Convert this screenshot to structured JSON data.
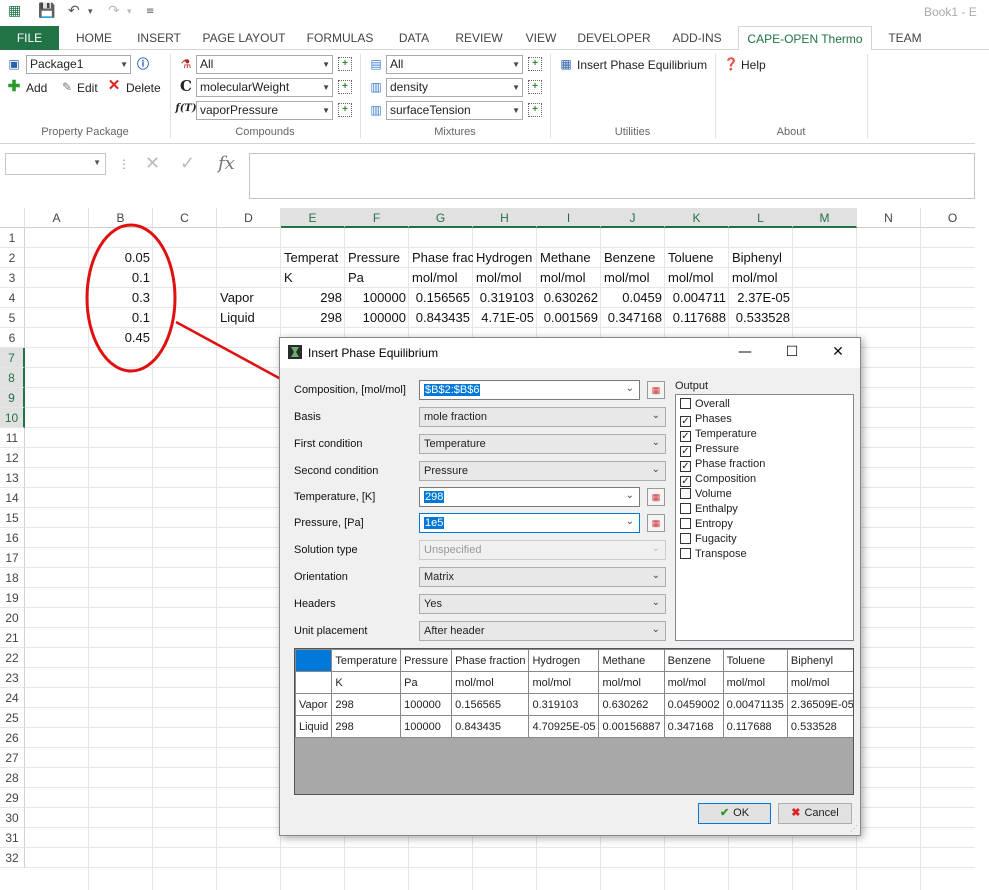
{
  "window": {
    "book_title": "Book1 - E"
  },
  "ribbon_tabs": [
    "FILE",
    "HOME",
    "INSERT",
    "PAGE LAYOUT",
    "FORMULAS",
    "DATA",
    "REVIEW",
    "VIEW",
    "DEVELOPER",
    "ADD-INS",
    "CAPE-OPEN Thermo",
    "TEAM"
  ],
  "ribbon": {
    "property_package": {
      "selected": "Package1",
      "add": "Add",
      "edit": "Edit",
      "delete": "Delete",
      "label": "Property Package"
    },
    "compounds": {
      "filter": "All",
      "prop1": "molecularWeight",
      "prop2": "vaporPressure",
      "c_glyph": "C",
      "f_glyph": "f(T)",
      "label": "Compounds"
    },
    "mixtures": {
      "filter": "All",
      "prop1": "density",
      "prop2": "surfaceTension",
      "label": "Mixtures"
    },
    "utilities": {
      "insert": "Insert Phase Equilibrium",
      "label": "Utilities"
    },
    "about": {
      "help": "Help",
      "label": "About"
    }
  },
  "formula_bar": {
    "fx": "fx",
    "value": ""
  },
  "sheet": {
    "columns": [
      "A",
      "B",
      "C",
      "D",
      "E",
      "F",
      "G",
      "H",
      "I",
      "J",
      "K",
      "L",
      "M",
      "N",
      "O"
    ],
    "rows": [
      "1",
      "2",
      "3",
      "4",
      "5",
      "6",
      "7",
      "8",
      "9",
      "10",
      "11",
      "12",
      "13",
      "14",
      "15",
      "16",
      "17",
      "18",
      "19",
      "20",
      "21",
      "22",
      "23",
      "24",
      "25",
      "26",
      "27",
      "28",
      "29",
      "30",
      "31",
      "32"
    ],
    "b_values": [
      "0.05",
      "0.1",
      "0.3",
      "0.1",
      "0.45"
    ],
    "d_labels": [
      "Vapor",
      "Liquid"
    ],
    "headers": [
      "Temperat",
      "Pressure",
      "Phase frac",
      "Hydrogen",
      "Methane",
      "Benzene",
      "Toluene",
      "Biphenyl"
    ],
    "units": [
      "K",
      "Pa",
      "mol/mol",
      "mol/mol",
      "mol/mol",
      "mol/mol",
      "mol/mol",
      "mol/mol"
    ],
    "vapor": [
      "298",
      "100000",
      "0.156565",
      "0.319103",
      "0.630262",
      "0.0459",
      "0.004711",
      "2.37E-05"
    ],
    "liquid": [
      "298",
      "100000",
      "0.843435",
      "4.71E-05",
      "0.001569",
      "0.347168",
      "0.117688",
      "0.533528"
    ]
  },
  "dialog": {
    "title": "Insert Phase Equilibrium",
    "fields": [
      {
        "label": "Composition, [mol/mol]",
        "value": "$B$2:$B$6"
      },
      {
        "label": "Basis",
        "value": "mole fraction"
      },
      {
        "label": "First condition",
        "value": "Temperature"
      },
      {
        "label": "Second condition",
        "value": "Pressure"
      },
      {
        "label": "Temperature, [K]",
        "value": "298"
      },
      {
        "label": "Pressure, [Pa]",
        "value": "1e5"
      },
      {
        "label": "Solution type",
        "value": "Unspecified"
      },
      {
        "label": "Orientation",
        "value": "Matrix"
      },
      {
        "label": "Headers",
        "value": "Yes"
      },
      {
        "label": "Unit placement",
        "value": "After header"
      }
    ],
    "output_label": "Output",
    "outputs": [
      {
        "label": "Overall",
        "checked": false
      },
      {
        "label": "Phases",
        "checked": true
      },
      {
        "label": "Temperature",
        "checked": true
      },
      {
        "label": "Pressure",
        "checked": true
      },
      {
        "label": "Phase fraction",
        "checked": true
      },
      {
        "label": "Composition",
        "checked": true
      },
      {
        "label": "Volume",
        "checked": false
      },
      {
        "label": "Enthalpy",
        "checked": false
      },
      {
        "label": "Entropy",
        "checked": false
      },
      {
        "label": "Fugacity",
        "checked": false
      },
      {
        "label": "Transpose",
        "checked": false
      }
    ],
    "preview": {
      "headers": [
        "Temperature",
        "Pressure",
        "Phase fraction",
        "Hydrogen",
        "Methane",
        "Benzene",
        "Toluene",
        "Biphenyl"
      ],
      "units": [
        "K",
        "Pa",
        "mol/mol",
        "mol/mol",
        "mol/mol",
        "mol/mol",
        "mol/mol",
        "mol/mol"
      ],
      "rows": [
        {
          "label": "Vapor",
          "values": [
            "298",
            "100000",
            "0.156565",
            "0.319103",
            "0.630262",
            "0.0459002",
            "0.00471135",
            "2.36509E-05"
          ]
        },
        {
          "label": "Liquid",
          "values": [
            "298",
            "100000",
            "0.843435",
            "4.70925E-05",
            "0.00156887",
            "0.347168",
            "0.117688",
            "0.533528"
          ]
        }
      ]
    },
    "ok": "OK",
    "cancel": "Cancel"
  },
  "colors": {
    "excel_green": "#217346",
    "selection_blue": "#0078d7",
    "callout_red": "#e01010"
  }
}
